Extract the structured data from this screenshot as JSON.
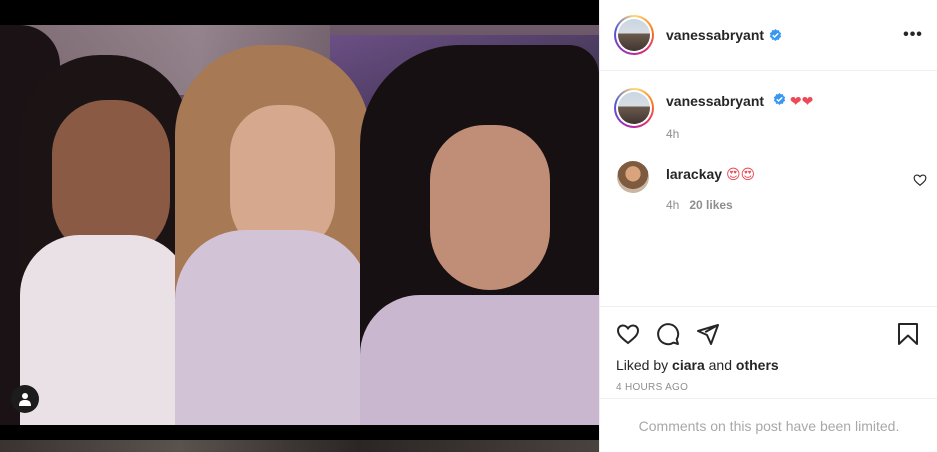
{
  "post": {
    "author": "vanessabryant",
    "more_icon": "•••",
    "verified_color": "#3897f0"
  },
  "caption": {
    "username": "vanessabryant",
    "text": "❤❤",
    "time": "4h"
  },
  "comment": {
    "username": "larackay",
    "text": "😍😍",
    "time": "4h",
    "likes": "20 likes"
  },
  "likes": {
    "prefix": "Liked by",
    "user": "ciara",
    "and": "and",
    "others": "others"
  },
  "timestamp": "4 HOURS AGO",
  "comments_limited": "Comments on this post have been limited.",
  "colors": {
    "accent": "#3897f0",
    "text": "#262626",
    "muted": "#8e8e8e",
    "heart": "#ed4956"
  },
  "icons": {
    "tag": "user-tag-icon",
    "more": "more-options-icon",
    "verified": "verified-badge-icon",
    "like": "heart-icon",
    "comment": "comment-icon",
    "share": "share-icon",
    "save": "bookmark-icon"
  }
}
